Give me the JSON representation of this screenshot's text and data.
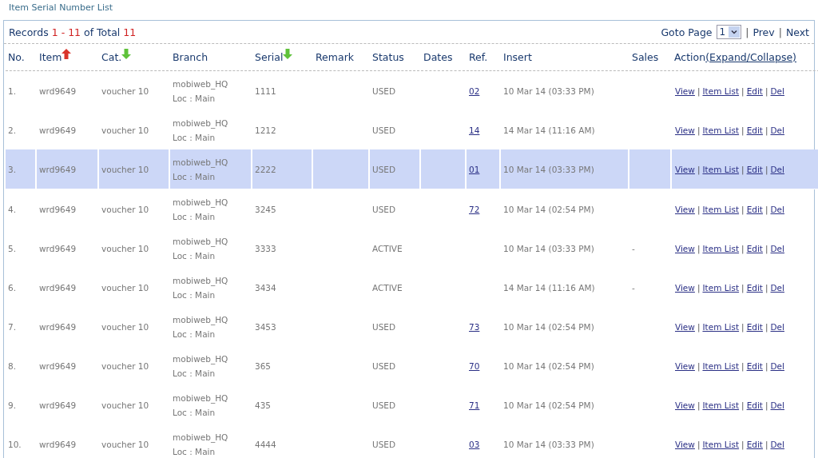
{
  "page_title": "Item Serial Number List",
  "records": {
    "label": "Records",
    "from": "1",
    "dash": "-",
    "to": "11",
    "of_total": "of Total",
    "total": "11"
  },
  "pager": {
    "label": "Goto Page",
    "page": "1",
    "separators": [
      "|",
      "|"
    ],
    "prev": "Prev",
    "next": "Next"
  },
  "columns": [
    {
      "label": "No."
    },
    {
      "label": "Item",
      "sort_up": true
    },
    {
      "label": "Cat.",
      "sort_up": false
    },
    {
      "label": "Branch"
    },
    {
      "label": "Serial",
      "sort_up": false
    },
    {
      "label": "Remark"
    },
    {
      "label": "Status"
    },
    {
      "label": "Dates"
    },
    {
      "label": "Ref."
    },
    {
      "label": "Insert"
    },
    {
      "label": "Sales"
    },
    {
      "label": "Action",
      "link": "(Expand/Collapse)"
    }
  ],
  "rows": [
    {
      "no": "1.",
      "item": "wrd9649",
      "cat": "voucher 10",
      "branch": "mobiweb_HQ",
      "loc": "Loc : Main",
      "serial": "1111",
      "status": "USED",
      "ref": "02",
      "insert": "10 Mar 14 (03:33 PM)",
      "selected": false,
      "actions": [
        "View",
        "Item List",
        "Edit",
        "Del"
      ],
      "separators": [
        "|",
        "|",
        "|"
      ]
    },
    {
      "no": "2.",
      "item": "wrd9649",
      "cat": "voucher 10",
      "branch": "mobiweb_HQ",
      "loc": "Loc : Main",
      "serial": "1212",
      "status": "USED",
      "ref": "14",
      "insert": "14 Mar 14 (11:16 AM)",
      "selected": false,
      "actions": [
        "View",
        "Item List",
        "Edit",
        "Del"
      ],
      "separators": [
        "|",
        "|",
        "|"
      ]
    },
    {
      "no": "3.",
      "item": "wrd9649",
      "cat": "voucher 10",
      "branch": "mobiweb_HQ",
      "loc": "Loc : Main",
      "serial": "2222",
      "status": "USED",
      "ref": "01",
      "insert": "10 Mar 14 (03:33 PM)",
      "selected": true,
      "actions": [
        "View",
        "Item List",
        "Edit",
        "Del"
      ],
      "separators": [
        "|",
        "|",
        "|"
      ]
    },
    {
      "no": "4.",
      "item": "wrd9649",
      "cat": "voucher 10",
      "branch": "mobiweb_HQ",
      "loc": "Loc : Main",
      "serial": "3245",
      "status": "USED",
      "ref": "72",
      "insert": "10 Mar 14 (02:54 PM)",
      "selected": false,
      "actions": [
        "View",
        "Item List",
        "Edit",
        "Del"
      ],
      "separators": [
        "|",
        "|",
        "|"
      ]
    },
    {
      "no": "5.",
      "item": "wrd9649",
      "cat": "voucher 10",
      "branch": "mobiweb_HQ",
      "loc": "Loc : Main",
      "serial": "3333",
      "status": "ACTIVE",
      "insert": "10 Mar 14 (03:33 PM)",
      "sales": "-",
      "selected": false,
      "actions": [
        "View",
        "Item List",
        "Edit",
        "Del"
      ],
      "separators": [
        "|",
        "|",
        "|"
      ]
    },
    {
      "no": "6.",
      "item": "wrd9649",
      "cat": "voucher 10",
      "branch": "mobiweb_HQ",
      "loc": "Loc : Main",
      "serial": "3434",
      "status": "ACTIVE",
      "insert": "14 Mar 14 (11:16 AM)",
      "sales": "-",
      "selected": false,
      "actions": [
        "View",
        "Item List",
        "Edit",
        "Del"
      ],
      "separators": [
        "|",
        "|",
        "|"
      ]
    },
    {
      "no": "7.",
      "item": "wrd9649",
      "cat": "voucher 10",
      "branch": "mobiweb_HQ",
      "loc": "Loc : Main",
      "serial": "3453",
      "status": "USED",
      "ref": "73",
      "insert": "10 Mar 14 (02:54 PM)",
      "selected": false,
      "actions": [
        "View",
        "Item List",
        "Edit",
        "Del"
      ],
      "separators": [
        "|",
        "|",
        "|"
      ]
    },
    {
      "no": "8.",
      "item": "wrd9649",
      "cat": "voucher 10",
      "branch": "mobiweb_HQ",
      "loc": "Loc : Main",
      "serial": "365",
      "status": "USED",
      "ref": "70",
      "insert": "10 Mar 14 (02:54 PM)",
      "selected": false,
      "actions": [
        "View",
        "Item List",
        "Edit",
        "Del"
      ],
      "separators": [
        "|",
        "|",
        "|"
      ]
    },
    {
      "no": "9.",
      "item": "wrd9649",
      "cat": "voucher 10",
      "branch": "mobiweb_HQ",
      "loc": "Loc : Main",
      "serial": "435",
      "status": "USED",
      "ref": "71",
      "insert": "10 Mar 14 (02:54 PM)",
      "selected": false,
      "actions": [
        "View",
        "Item List",
        "Edit",
        "Del"
      ],
      "separators": [
        "|",
        "|",
        "|"
      ]
    },
    {
      "no": "10.",
      "item": "wrd9649",
      "cat": "voucher 10",
      "branch": "mobiweb_HQ",
      "loc": "Loc : Main",
      "serial": "4444",
      "status": "USED",
      "ref": "03",
      "insert": "10 Mar 14 (03:33 PM)",
      "selected": false,
      "actions": [
        "View",
        "Item List",
        "Edit",
        "Del"
      ],
      "separators": [
        "|",
        "|",
        "|"
      ]
    }
  ]
}
